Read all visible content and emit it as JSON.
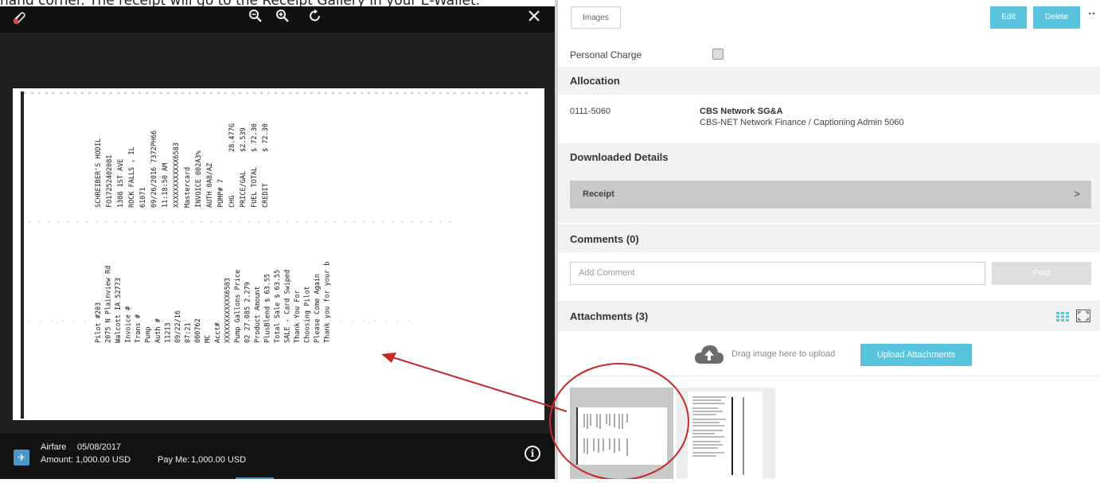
{
  "caption": "hand corner. The receipt will go to the Receipt Gallery in your E-Wallet.",
  "viewer": {
    "toolbar": {
      "icons": [
        "attachment-slash-icon",
        "zoom-out-icon",
        "zoom-in-icon",
        "rotate-icon",
        "close-icon"
      ]
    },
    "footer": {
      "category": "Airfare",
      "date": "05/08/2017",
      "amount_label": "Amount:",
      "amount_value": "1,000.00 USD",
      "payme_label": "Pay Me:",
      "payme_value": "1,000.00 USD"
    },
    "receipt_lines": [
      "SCHREIBER'S HODIL",
      "FO1725240208I",
      "1308 1ST AVE",
      "ROCK FALLS , IL",
      "61071",
      "09/26/2016 7372PH66",
      "11:18:50 AM",
      "XXXXXXXXXXXX6583",
      "Mastercard",
      "INVOICE 002A3%",
      "AUTH 0A8/AZ",
      "PUMP# 7",
      "CHG",
      "PRICE/GAL",
      "FUEL TOTAL",
      "CREDIT",
      "28.477G",
      "$2.539",
      "$ 72.30",
      "$ 72.30",
      "Pilot #203",
      "2075 N Plainview Rd",
      "Walcott IA 52773",
      "Invoice #",
      "Trans #",
      "Pump",
      "Auth #",
      "11213",
      "09/22/16",
      "07:21",
      "000762",
      "MC",
      "Acct#",
      "XXXXXXXXXXXX6583",
      "Pump  Gallons  Price",
      "02   27.085  2.279",
      "Product   Amount",
      "PlusBlend  $ 63.55",
      "Total Sale  $ 63.55",
      "SALE - Card Swiped",
      "Thank You For",
      "Choosing Pilot",
      "Please Come Again",
      "Thank you for your b"
    ]
  },
  "panel": {
    "images_button": "Images",
    "edit_button": "Edit",
    "delete_button": "Delete",
    "more_icon": "··",
    "personal_charge_label": "Personal Charge",
    "allocation": {
      "title": "Allocation",
      "code": "0111-5060",
      "name": "CBS Network SG&A",
      "description": "CBS-NET Network Finance / Captioning Admin 5060"
    },
    "downloaded_details": {
      "title": "Downloaded Details",
      "receipt_label": "Receipt",
      "chevron": ">"
    },
    "comments": {
      "title": "Comments",
      "count": "(0)",
      "placeholder": "Add Comment",
      "post_button": "Post"
    },
    "attachments": {
      "title": "Attachments",
      "count": "(3)",
      "drag_text": "Drag image here to upload",
      "upload_button": "Upload Attachments"
    }
  },
  "colors": {
    "accent": "#5ac3dd",
    "annotation": "#c62828",
    "viewer_bg": "#1e1e1e"
  }
}
